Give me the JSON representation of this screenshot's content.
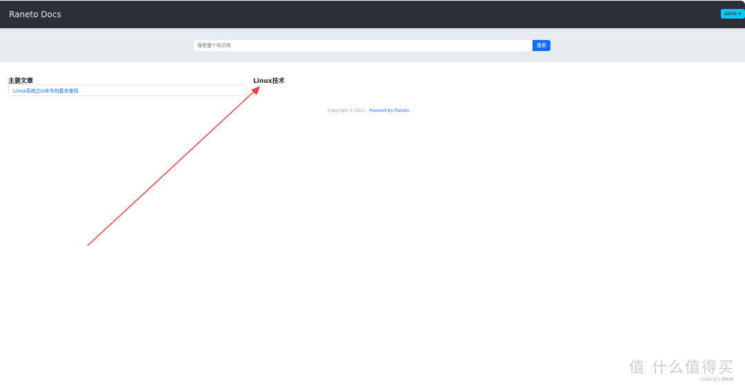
{
  "navbar": {
    "brand": "Raneto Docs",
    "user_button": "admin ▾"
  },
  "search": {
    "placeholder": "搜索整个知识库",
    "button": "搜索"
  },
  "main": {
    "section_title": "主要文章",
    "articles": [
      {
        "title": "Linux系统之ls命令的基本使用"
      }
    ],
    "category_title": "Linux技术"
  },
  "footer": {
    "copyright": "Copyright © 2023 - ",
    "powered": "Powered by Raneto"
  },
  "watermark": {
    "logo": "值 什么值得买",
    "credit": "CSDN @江湖有缘"
  },
  "annotation": {
    "arrow_color": "#f03c3c"
  }
}
